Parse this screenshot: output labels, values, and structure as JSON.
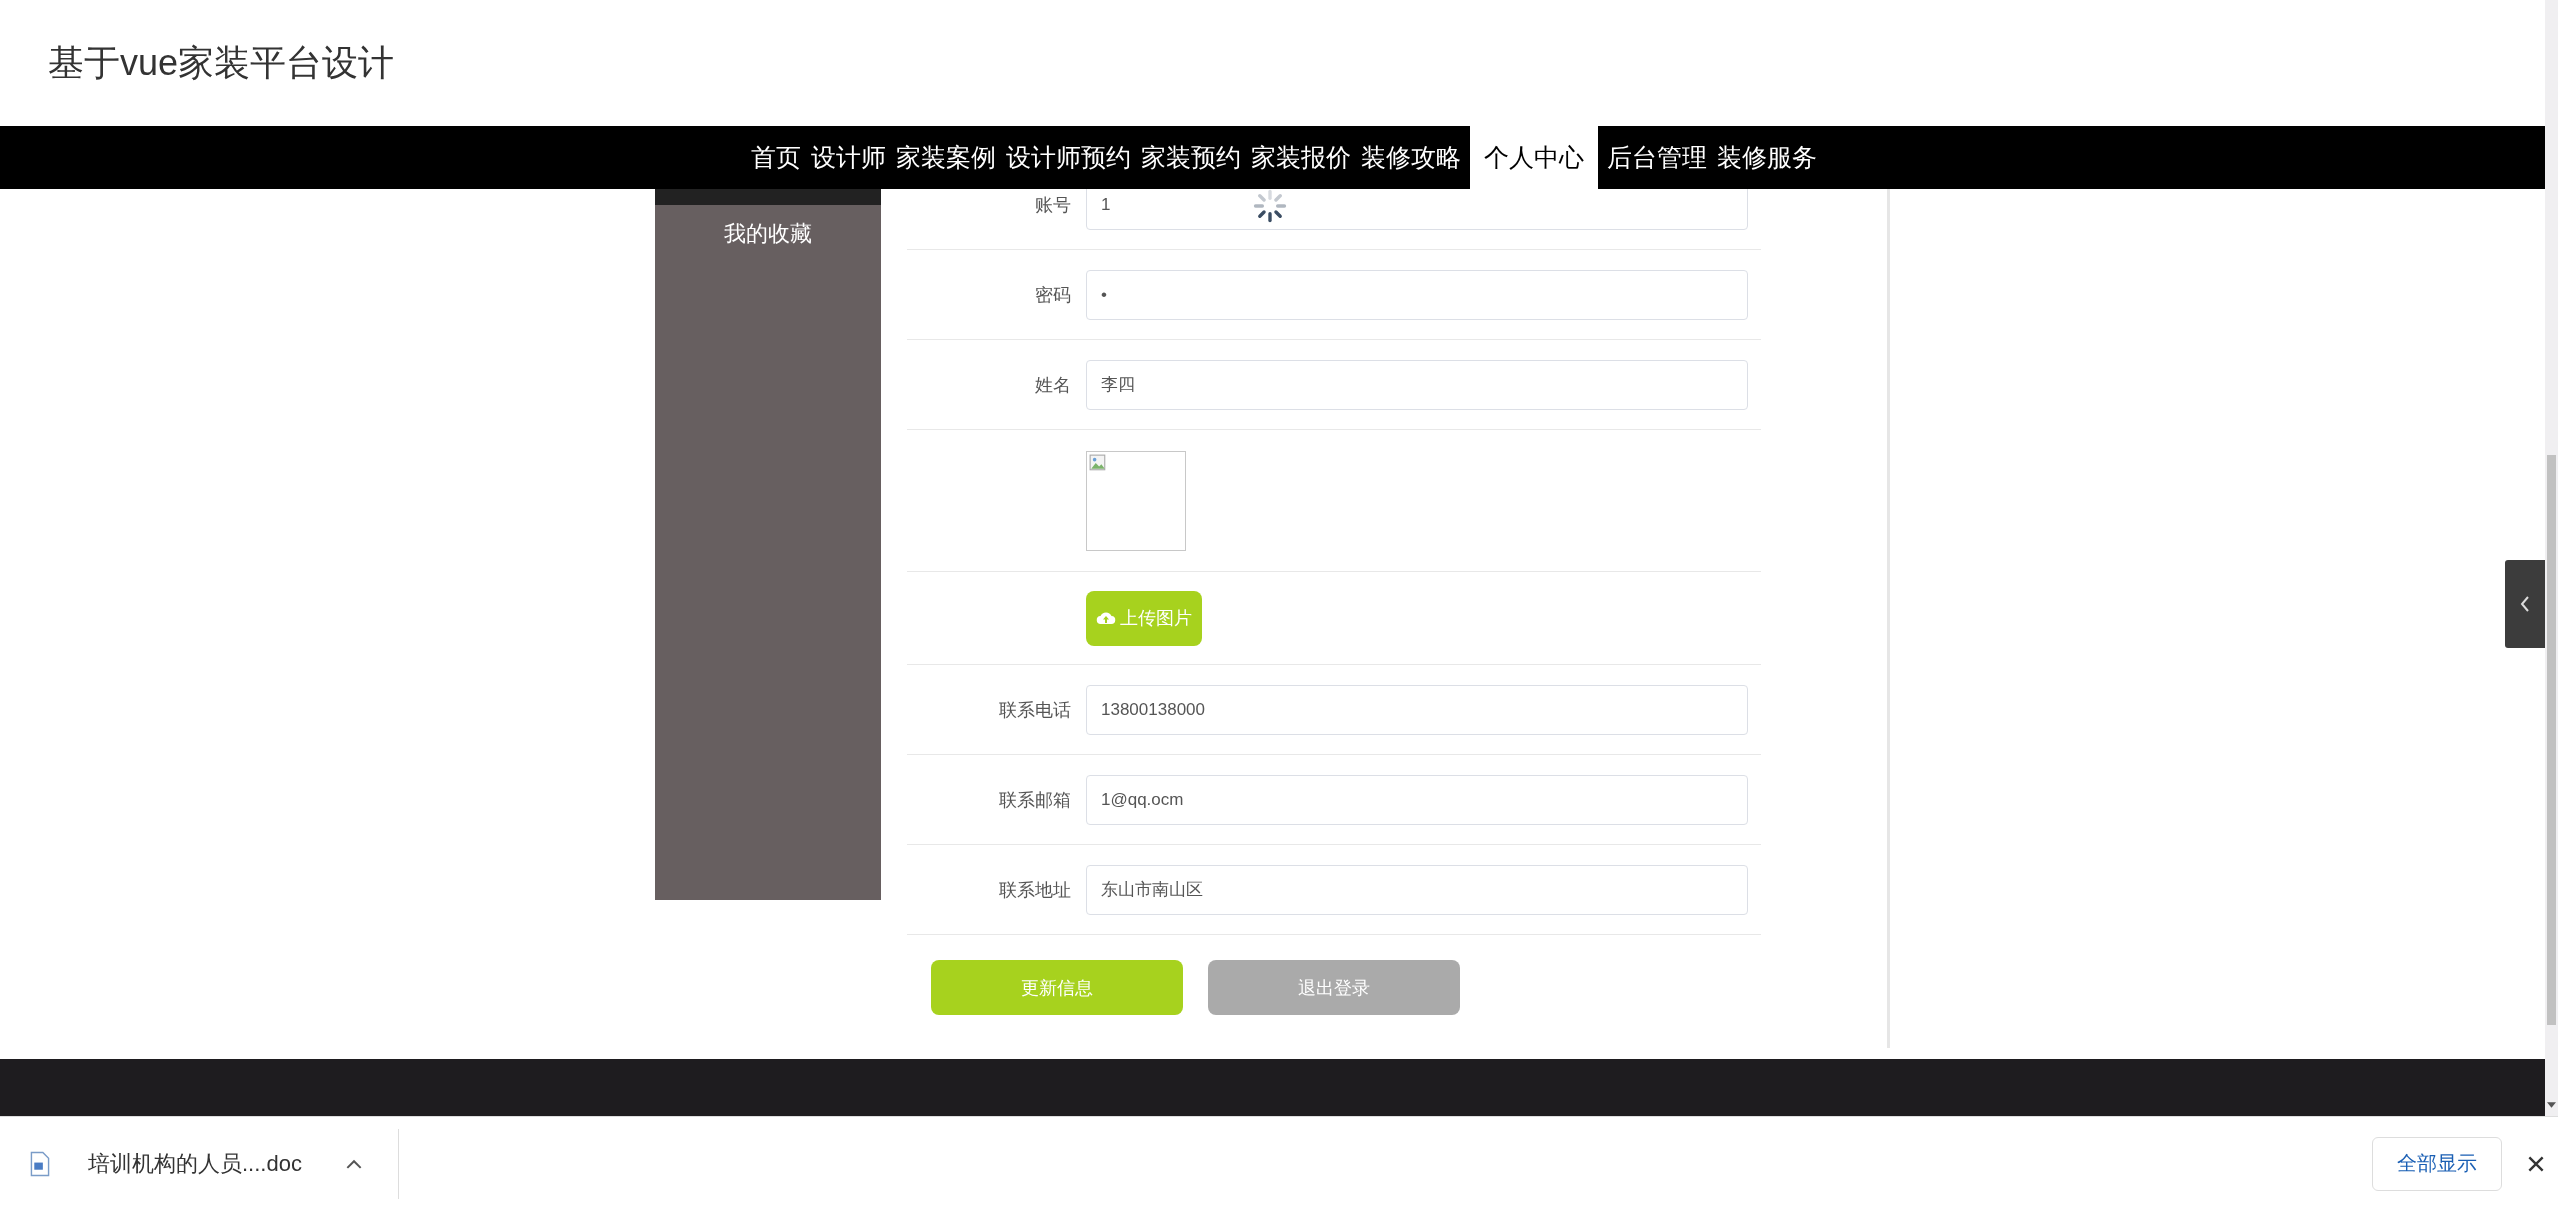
{
  "header": {
    "title": "基于vue家装平台设计"
  },
  "nav": [
    {
      "label": "首页",
      "selected": false
    },
    {
      "label": "设计师",
      "selected": false
    },
    {
      "label": "家装案例",
      "selected": false
    },
    {
      "label": "设计师预约",
      "selected": false
    },
    {
      "label": "家装预约",
      "selected": false
    },
    {
      "label": "家装报价",
      "selected": false
    },
    {
      "label": "装修攻略",
      "selected": false
    },
    {
      "label": "个人中心",
      "selected": true
    },
    {
      "label": "后台管理",
      "selected": false
    },
    {
      "label": "装修服务",
      "selected": false
    }
  ],
  "sidebar": {
    "items": [
      {
        "label": "我的收藏"
      }
    ]
  },
  "form": {
    "fields": [
      {
        "kind": "text",
        "label": "账号",
        "value": "1"
      },
      {
        "kind": "text",
        "label": "密码",
        "value": "•"
      },
      {
        "kind": "text",
        "label": "姓名",
        "value": "李四"
      },
      {
        "kind": "image"
      },
      {
        "kind": "upload",
        "button": "上传图片"
      },
      {
        "kind": "text",
        "label": "联系电话",
        "value": "13800138000"
      },
      {
        "kind": "text",
        "label": "联系邮箱",
        "value": "1@qq.ocm"
      },
      {
        "kind": "text",
        "label": "联系地址",
        "value": "东山市南山区"
      }
    ],
    "buttons": [
      {
        "kind": "primary",
        "label": "更新信息"
      },
      {
        "kind": "secondary",
        "label": "退出登录"
      }
    ]
  },
  "downloads": {
    "items": [
      {
        "name": "培训机构的人员....doc"
      }
    ],
    "show_all": "全部显示"
  }
}
